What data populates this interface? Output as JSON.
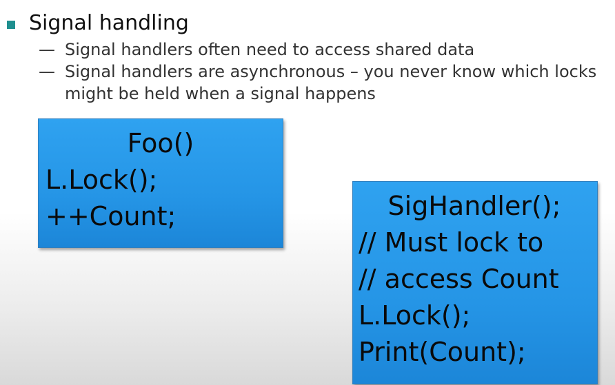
{
  "slide": {
    "bullet": "Signal handling",
    "sub_items": [
      "Signal handlers often need to access shared data",
      "Signal handlers are asynchronous – you never know which locks might be held when a signal happens"
    ],
    "dash": "—"
  },
  "foo_box": {
    "title": "Foo()",
    "lines": [
      "L.Lock();",
      "++Count;"
    ]
  },
  "sig_box": {
    "title": "SigHandler();",
    "lines": [
      "// Must lock to",
      "// access Count",
      "L.Lock();",
      "Print(Count);"
    ]
  },
  "colors": {
    "bullet": "#1f8f8f",
    "box_fill": "#2595e6",
    "text": "#111111"
  }
}
